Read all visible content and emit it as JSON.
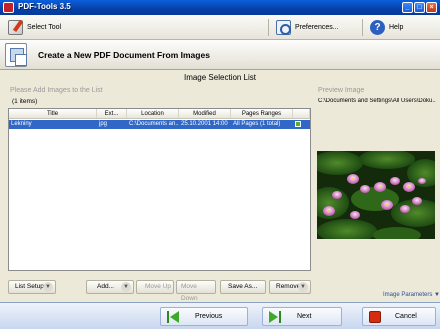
{
  "window": {
    "title": "PDF-Tools 3.5",
    "controls": [
      "_",
      "□",
      "×"
    ]
  },
  "toolbar": {
    "select_tool": "Select Tool",
    "preferences": "Preferences...",
    "help": "Help",
    "help_icon_glyph": "?"
  },
  "header": {
    "title": "Create a New PDF Document From Images"
  },
  "section": {
    "title": "Image Selection List"
  },
  "list_panel": {
    "label": "Please Add Images to the List",
    "count": "(1 items)",
    "columns": [
      "Title",
      "Ext...",
      "Location",
      "Modified",
      "Pages Ranges",
      ""
    ],
    "rows": [
      {
        "title": "Lekniny",
        "ext": "jpg",
        "location": "C:\\Documents an...",
        "modified": "25.10.2001 14:00",
        "pages": "All Pages (1 total)"
      }
    ]
  },
  "list_buttons": {
    "list_setup": "List Setup",
    "add": "Add...",
    "move_up": "Move Up",
    "move_down": "Move Down",
    "save_as": "Save As...",
    "remove": "Remove",
    "arrow_glyph": "▼"
  },
  "preview": {
    "label": "Preview Image",
    "path": "C:\\Documents and Settings\\All Users\\Doku...",
    "params": "Image Parameters",
    "params_arrow": "▼"
  },
  "navigation": {
    "previous": "Previous",
    "next": "Next",
    "cancel": "Cancel"
  },
  "colors": {
    "selection": "#3168c8",
    "title_bar": "#0a5fdc",
    "nav_arrow": "#3cab28",
    "cancel": "#d62c10"
  }
}
